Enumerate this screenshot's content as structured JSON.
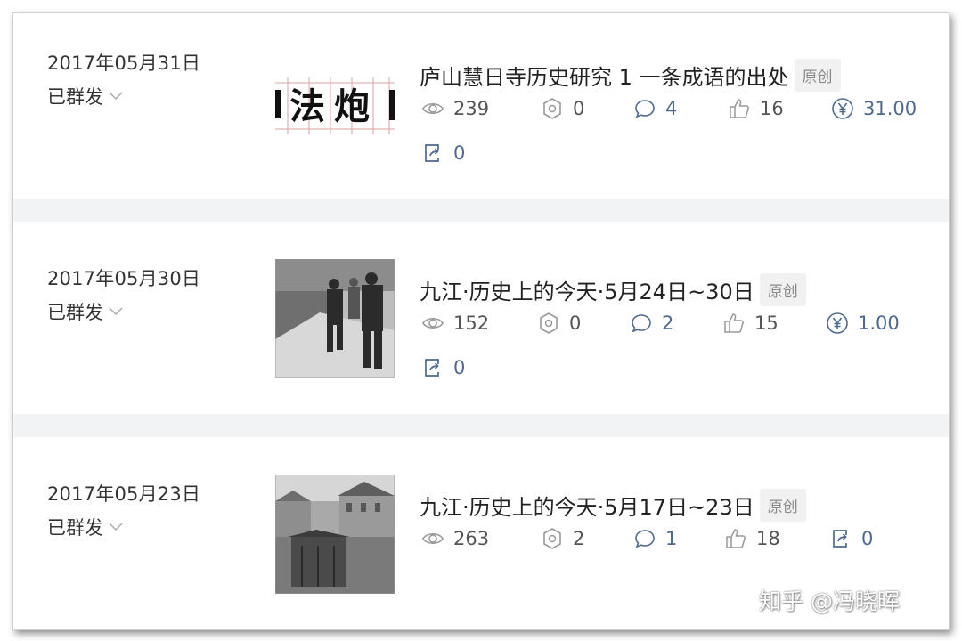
{
  "articles": [
    {
      "date": "2017年05月31日",
      "status": "已群发",
      "title": "庐山慧日寺历史研究 1 一条成语的出处",
      "badge": "原创",
      "thumb_text": "法炮",
      "views": "239",
      "shares": "0",
      "comments": "4",
      "likes": "16",
      "reward": "31.00",
      "reposts": "0"
    },
    {
      "date": "2017年05月30日",
      "status": "已群发",
      "title": "九江·历史上的今天·5月24日~30日",
      "badge": "原创",
      "views": "152",
      "shares": "0",
      "comments": "2",
      "likes": "15",
      "reward": "1.00",
      "reposts": "0"
    },
    {
      "date": "2017年05月23日",
      "status": "已群发",
      "title": "九江·历史上的今天·5月17日~23日",
      "badge": "原创",
      "views": "263",
      "shares": "2",
      "comments": "1",
      "likes": "18",
      "reposts": "0"
    }
  ],
  "watermark": "知乎 @冯晓晖",
  "colors": {
    "accent": "#4f6a8f",
    "text": "#333333",
    "badge_bg": "#f1f1f1"
  },
  "icons": [
    "eye-icon",
    "share-network-icon",
    "comment-icon",
    "thumbs-up-icon",
    "yen-icon",
    "repost-icon",
    "chevron-down-icon"
  ]
}
